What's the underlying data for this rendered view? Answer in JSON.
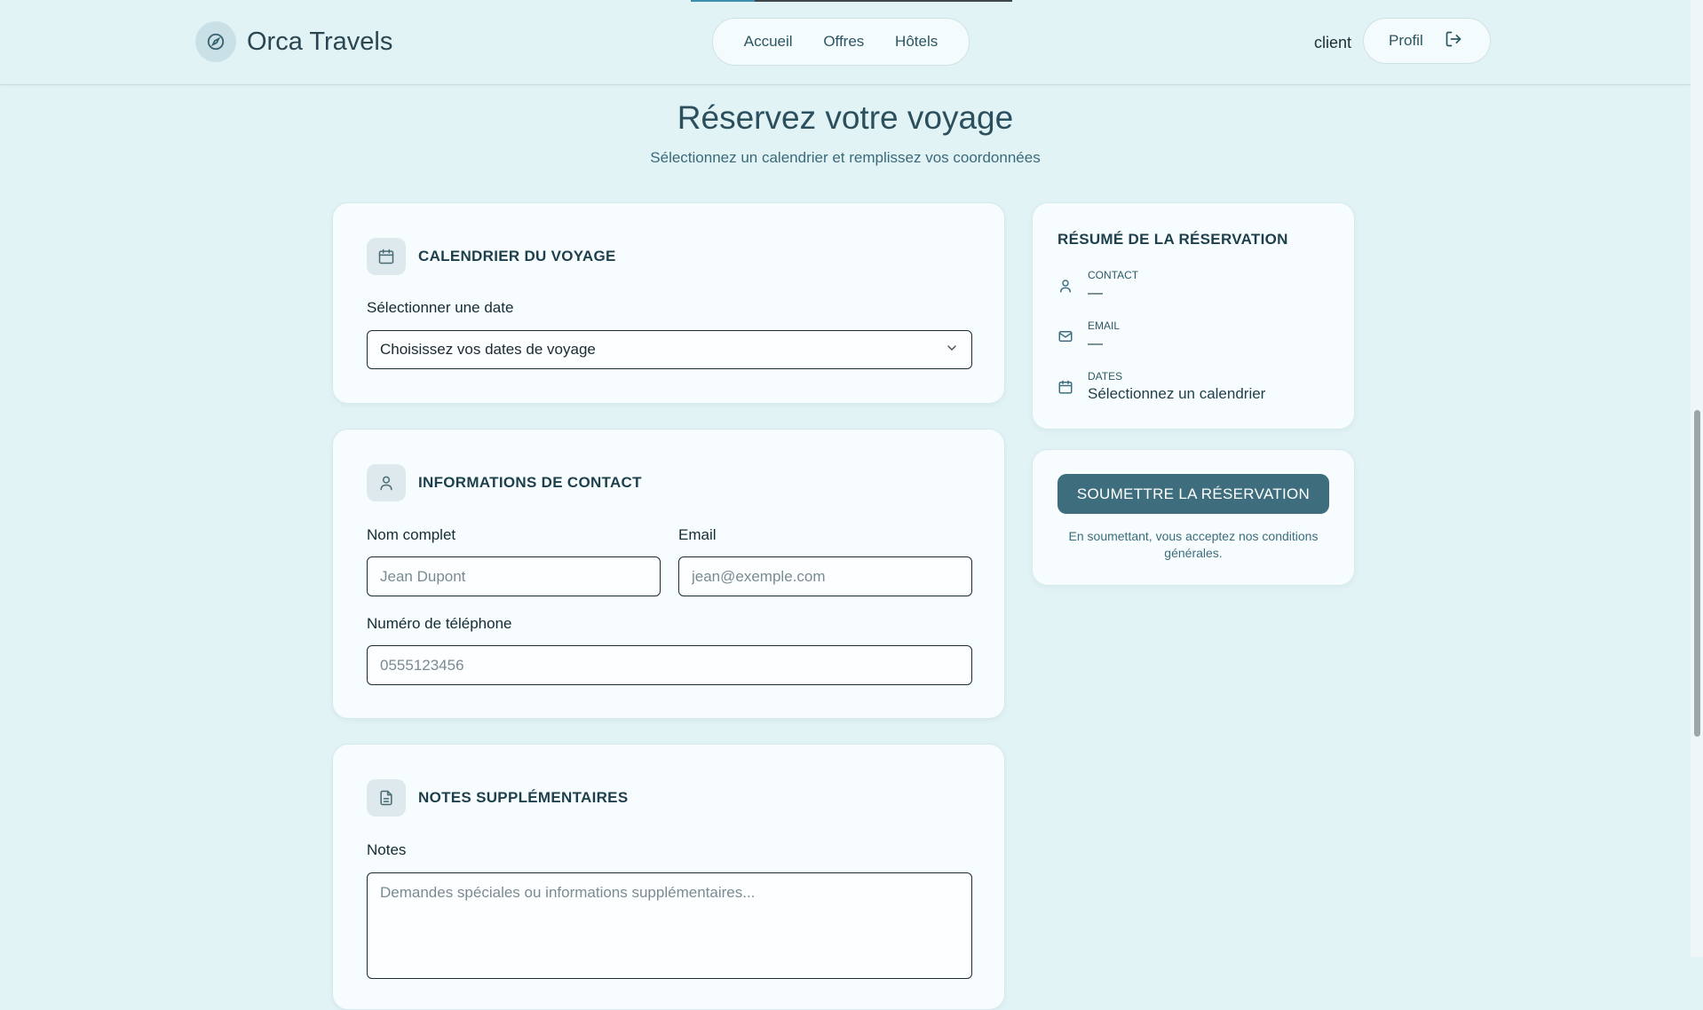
{
  "header": {
    "brand": "Orca Travels",
    "nav": [
      "Accueil",
      "Offres",
      "Hôtels"
    ],
    "user": "client",
    "profile": "Profil"
  },
  "page": {
    "title": "Réservez votre voyage",
    "subtitle": "Sélectionnez un calendrier et remplissez vos coordonnées"
  },
  "calendar_card": {
    "title": "CALENDRIER DU VOYAGE",
    "label": "Sélectionner une date",
    "select_value": "Choisissez vos dates de voyage"
  },
  "contact_card": {
    "title": "INFORMATIONS DE CONTACT",
    "name_label": "Nom complet",
    "name_placeholder": "Jean Dupont",
    "email_label": "Email",
    "email_placeholder": "jean@exemple.com",
    "phone_label": "Numéro de téléphone",
    "phone_placeholder": "0555123456"
  },
  "notes_card": {
    "title": "NOTES SUPPLÉMENTAIRES",
    "label": "Notes",
    "placeholder": "Demandes spéciales ou informations supplémentaires..."
  },
  "summary": {
    "title": "RÉSUMÉ DE LA RÉSERVATION",
    "rows": [
      {
        "key": "CONTACT",
        "value": "—"
      },
      {
        "key": "EMAIL",
        "value": "—"
      },
      {
        "key": "DATES",
        "value": "Sélectionnez un calendrier"
      }
    ]
  },
  "submit": {
    "button": "SOUMETTRE LA RÉSERVATION",
    "terms": "En soumettant, vous acceptez nos conditions générales."
  },
  "icons": {
    "brand": "compass-icon",
    "logout": "logout-icon",
    "calendar": "calendar-icon",
    "user": "user-icon",
    "document": "document-icon",
    "mail": "mail-icon",
    "chevron": "chevron-down-icon"
  },
  "colors": {
    "background": "#e2f3f6",
    "card": "#f7fdfe",
    "accent": "#3e6e7d",
    "heading": "#1d3f4b"
  }
}
